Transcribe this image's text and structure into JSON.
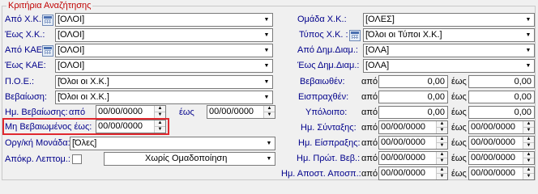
{
  "group_title": "Κριτήρια Αναζήτησης",
  "left": {
    "apo_xk": {
      "label": "Από Χ.Κ.:",
      "value": "[ΟΛΟΙ]"
    },
    "eos_xk": {
      "label": "Έως Χ.Κ.:",
      "value": "[ΟΛΟΙ]"
    },
    "apo_kae": {
      "label": "Από ΚΑΕ:",
      "value": "[ΟΛΟΙ]"
    },
    "eos_kae": {
      "label": "Έως ΚΑΕ:",
      "value": "[ΟΛΟΙ]"
    },
    "poe": {
      "label": "Π.Ο.Ε.:",
      "value": "[Όλοι οι Χ.Κ.]"
    },
    "bebaiosi": {
      "label": "Βεβαίωση:",
      "value": "[Όλοι οι Χ.Κ.]"
    },
    "im_bebaiosis": {
      "label": "Ημ. Βεβαίωσης:",
      "from_label": "από",
      "from_value": "00/00/0000",
      "to_label": "έως",
      "to_value": "00/00/0000"
    },
    "mi_bebaiomenos": {
      "label": "Μη Βεβαιωμένος έως:",
      "value": "00/00/0000"
    },
    "org_monada": {
      "label": "Οργ/κή Μονάδα:",
      "value": "[Όλες]"
    },
    "apokr": {
      "label": "Απόκρ. Λεπτομ.:",
      "grouping": "Χωρίς Ομαδοποίηση"
    }
  },
  "right": {
    "omada_xk": {
      "label": "Ομάδα Χ.Κ.:",
      "value": "[ΟΛΕΣ]"
    },
    "typos_xk": {
      "label": "Τύπος Χ.Κ. :",
      "value": "[Όλοι οι Τύποι Χ.Κ.]"
    },
    "apo_dim": {
      "label": "Από Δημ.Διαμ.:",
      "value": "[ΟΛΑ]"
    },
    "eos_dim": {
      "label": "Έως Δημ.Διαμ.:",
      "value": "[ΟΛΑ]"
    },
    "bebaiothen": {
      "label": "Βεβαιωθέν:",
      "from_label": "από",
      "from_value": "0,00",
      "to_label": "έως",
      "to_value": "0,00"
    },
    "eispraxthen": {
      "label": "Εισπραχθέν:",
      "from_label": "από",
      "from_value": "0,00",
      "to_label": "έως",
      "to_value": "0,00"
    },
    "ypoloipo": {
      "label": "Υπόλοιπο:",
      "from_label": "από",
      "from_value": "0,00",
      "to_label": "έως",
      "to_value": "0,00"
    },
    "im_syntaxis": {
      "label": "Ημ. Σύνταξης:",
      "from_label": "από",
      "from_value": "00/00/0000",
      "to_label": "έως",
      "to_value": "00/00/0000"
    },
    "im_eispraxis": {
      "label": "Ημ. Είσπραξης:",
      "from_label": "από",
      "from_value": "00/00/0000",
      "to_label": "έως",
      "to_value": "00/00/0000"
    },
    "im_prot": {
      "label": "Ημ. Πρώτ. Βεβ.:",
      "from_label": "από",
      "from_value": "00/00/0000",
      "to_label": "έως",
      "to_value": "00/00/0000"
    },
    "im_apost": {
      "label": "Ημ. Αποστ. Αποσπ.:",
      "from_label": "από",
      "from_value": "00/00/0000",
      "to_label": "έως",
      "to_value": "00/00/0000"
    }
  }
}
